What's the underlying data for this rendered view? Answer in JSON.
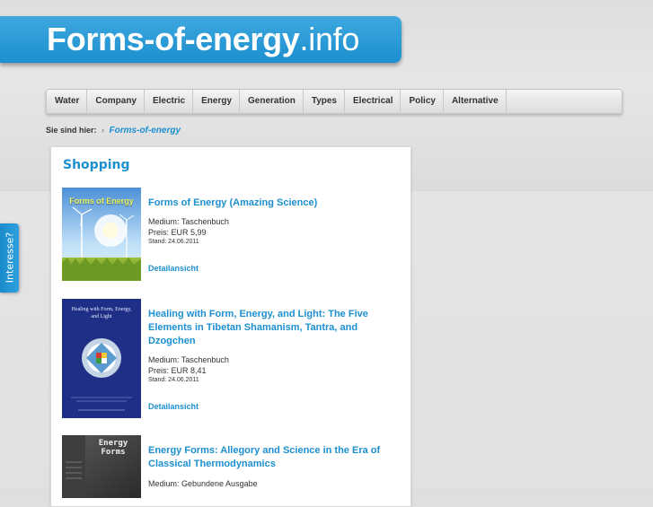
{
  "site": {
    "title_main": "Forms-of-energy",
    "title_ext": ".info"
  },
  "nav": {
    "items": [
      {
        "label": "Water"
      },
      {
        "label": "Company"
      },
      {
        "label": "Electric"
      },
      {
        "label": "Energy"
      },
      {
        "label": "Generation"
      },
      {
        "label": "Types"
      },
      {
        "label": "Electrical"
      },
      {
        "label": "Policy"
      },
      {
        "label": "Alternative"
      }
    ]
  },
  "breadcrumb": {
    "label": "Sie sind hier:",
    "separator": "›",
    "current": "Forms-of-energy"
  },
  "section": {
    "title": "Shopping"
  },
  "products": [
    {
      "title": "Forms of Energy (Amazing Science)",
      "medium": "Medium: Taschenbuch",
      "price": "Preis: EUR 5,99",
      "date": "Stand: 24.06.2011",
      "link": "Detailansicht",
      "cover_text": "Forms of Energy"
    },
    {
      "title": "Healing with Form, Energy, and Light: The Five Elements in Tibetan Shamanism, Tantra, and Dzogchen",
      "medium": "Medium: Taschenbuch",
      "price": "Preis: EUR 8,41",
      "date": "Stand: 24.06.2011",
      "link": "Detailansicht",
      "cover_text": "Healing with Form, Energy, and Light"
    },
    {
      "title": "Energy Forms: Allegory and Science in the Era of Classical Thermodynamics",
      "medium": "Medium: Gebundene Ausgabe",
      "cover_text": "Energy Forms"
    }
  ],
  "side_tab": {
    "label": "Interesse?"
  },
  "colors": {
    "accent": "#1c8fcf",
    "header": "#2a9bd8",
    "background": "#e2e2e2"
  }
}
